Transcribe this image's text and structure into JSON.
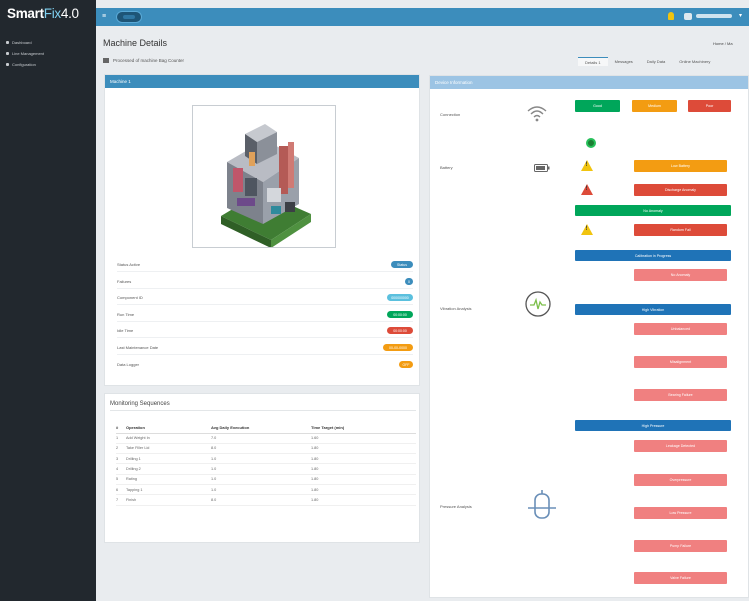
{
  "app": {
    "logo_smart": "Smart",
    "logo_fix": "Fix",
    "logo_version": "4.0"
  },
  "sidebar": {
    "items": [
      {
        "label": "Dashboard"
      },
      {
        "label": "Line Management"
      },
      {
        "label": "Configuration"
      }
    ]
  },
  "topbar": {
    "menu_icon": "hamburger-icon",
    "bell_icon": "bell-icon",
    "user_icon": "user-icon"
  },
  "page": {
    "title": "Machine Details",
    "breadcrumb": "Home / Ma",
    "subtitle": "Processed of machine Bag Counter"
  },
  "tabs": [
    {
      "label": "Details 1",
      "active": true
    },
    {
      "label": "Messages",
      "active": false
    },
    {
      "label": "Daily Data",
      "active": false
    },
    {
      "label": "Online Machinery",
      "active": false
    }
  ],
  "left_panel": {
    "title": "Machine 1",
    "rows": [
      {
        "label": "Status Active",
        "badge": "Status",
        "color": "#3c8dbc"
      },
      {
        "label": "Failures",
        "badge": "0",
        "color": "#3c8dbc"
      },
      {
        "label": "Component ID",
        "badge": "000000000",
        "color": "#5bc0de"
      },
      {
        "label": "Run Time",
        "badge": "00:00:00",
        "color": "#00a65a"
      },
      {
        "label": "Idle Time",
        "badge": "00:00:00",
        "color": "#dd4b39"
      },
      {
        "label": "Last Maintenance Date",
        "badge": "00-00-0000",
        "color": "#f39c12"
      },
      {
        "label": "Data Logger",
        "badge": "OFF",
        "color": "#f39c12"
      }
    ]
  },
  "monitoring": {
    "title": "Monitoring Sequences",
    "columns": [
      "#",
      "Operation",
      "Avg Daily Execution",
      "Time Target (min)"
    ],
    "rows": [
      [
        "1",
        "Add Weight In",
        "7.0",
        "1.60"
      ],
      [
        "2",
        "Take Filler Lid",
        "8.0",
        "1.80"
      ],
      [
        "3",
        "Drilling 1",
        "1.0",
        "1.80"
      ],
      [
        "4",
        "Drilling 2",
        "1.0",
        "1.80"
      ],
      [
        "5",
        "Rating",
        "1.0",
        "1.80"
      ],
      [
        "6",
        "Tapping 1",
        "1.0",
        "1.80"
      ],
      [
        "7",
        "Finish",
        "8.0",
        "1.80"
      ]
    ]
  },
  "right_panel": {
    "title": "Device Information",
    "sections": {
      "connection": "Connection",
      "battery": "Battery",
      "vibration": "Vibration Analysis",
      "pressure": "Pressure Analysis"
    },
    "status_buttons": {
      "good": "Good",
      "medium": "Medium",
      "poor": "Poor"
    },
    "battery_items": {
      "low": "Low Battery",
      "discharge": "Discharge Anomaly"
    },
    "banners": {
      "no_anomaly": "No Anomaly",
      "random_fail": "Random Fail",
      "calibration": "Calibration in Progress",
      "no_anomaly_2": "No Anomaly"
    },
    "vibration_items": [
      "High Vibration",
      "Unbalanced",
      "Misalignment",
      "Bearing Failure"
    ],
    "pressure_banner": "High Pressure",
    "pressure_items": [
      "Leakage Detected",
      "Overpressure",
      "Low Pressure",
      "Pump Failure",
      "Valve Failure"
    ]
  }
}
